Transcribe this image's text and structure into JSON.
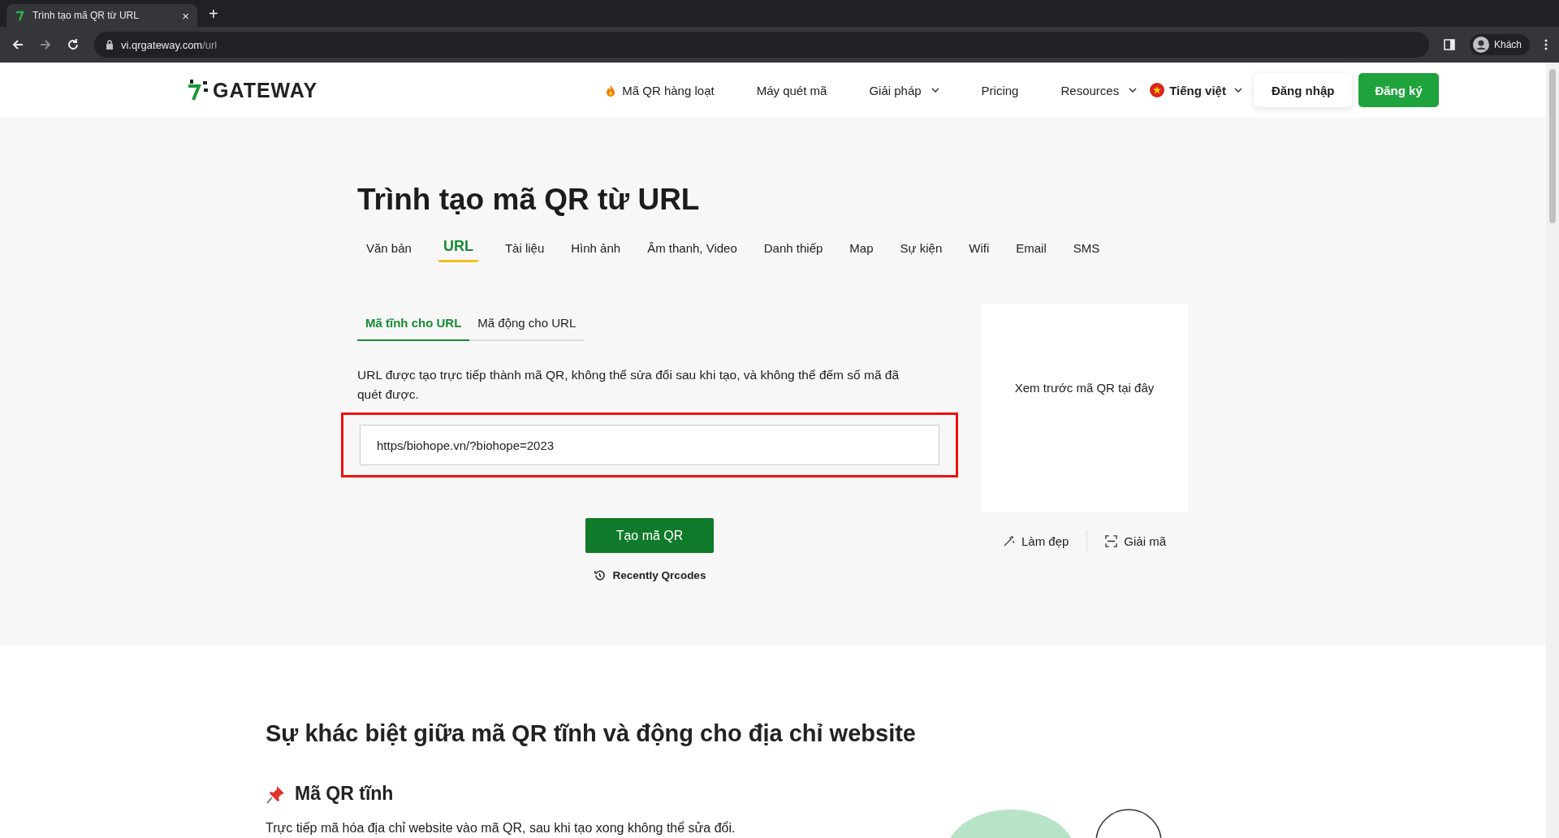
{
  "browser": {
    "tab_title": "Trình tạo mã QR từ URL",
    "close_glyph": "×",
    "new_tab_glyph": "+",
    "url_host": "vi.qrgateway.com",
    "url_path": "/url",
    "profile": "Khách"
  },
  "nav": {
    "logo": "GATEWAY",
    "items": [
      {
        "label": "Mã QR hàng loạt",
        "kind": "flame",
        "has_dropdown": false
      },
      {
        "label": "Máy quét mã",
        "kind": "plain",
        "has_dropdown": false
      },
      {
        "label": "Giải pháp",
        "kind": "plain",
        "has_dropdown": true
      },
      {
        "label": "Pricing",
        "kind": "plain",
        "has_dropdown": false
      },
      {
        "label": "Resources",
        "kind": "plain",
        "has_dropdown": true
      }
    ],
    "language": "Tiếng việt",
    "login": "Đăng nhập",
    "signup": "Đăng ký"
  },
  "hero": {
    "title": "Trình tạo mã QR từ URL",
    "type_tabs": [
      {
        "label": "Văn bản",
        "selected": false
      },
      {
        "label": "URL",
        "selected": true
      },
      {
        "label": "Tài liệu",
        "selected": false
      },
      {
        "label": "Hình ảnh",
        "selected": false
      },
      {
        "label": "Âm thanh, Video",
        "selected": false
      },
      {
        "label": "Danh thiếp",
        "selected": false
      },
      {
        "label": "Map",
        "selected": false
      },
      {
        "label": "Sự kiện",
        "selected": false
      },
      {
        "label": "Wifi",
        "selected": false
      },
      {
        "label": "Email",
        "selected": false
      },
      {
        "label": "SMS",
        "selected": false
      }
    ],
    "mode_tabs": [
      {
        "label": "Mã tĩnh cho URL",
        "selected": true
      },
      {
        "label": "Mã động cho URL",
        "selected": false
      }
    ],
    "description": "URL được tạo trực tiếp thành mã QR, không thể sửa đổi sau khi tạo, và không thể đếm số mã đã quét được.",
    "url_input": {
      "value": "https/biohope.vn/?biohope=2023",
      "highlighted": true
    },
    "generate_button": "Tạo mã QR",
    "recent_link": "Recently Qrcodes",
    "preview_text": "Xem trước mã QR tại đây",
    "actions": [
      {
        "label": "Làm đẹp",
        "kind": "beautify"
      },
      {
        "label": "Giải mã",
        "kind": "decode"
      }
    ]
  },
  "section": {
    "heading": "Sự khác biệt giữa mã QR tĩnh và động cho địa chỉ website",
    "subheading": "Mã QR tĩnh",
    "text": "Trực tiếp mã hóa địa chỉ website vào mã QR, sau khi tạo xong không thể sửa đổi."
  }
}
